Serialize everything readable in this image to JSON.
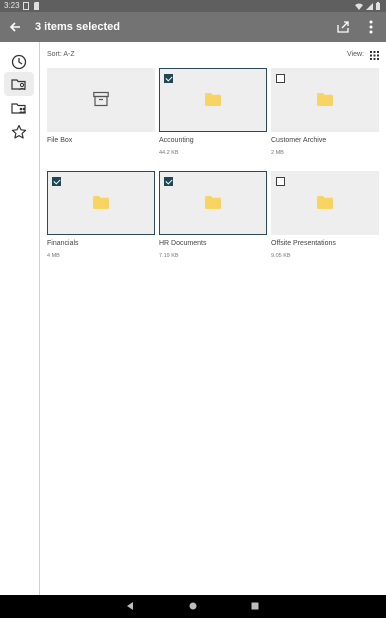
{
  "statusbar": {
    "time": "3:23"
  },
  "appbar": {
    "title": "3 items selected",
    "back_icon": "arrow-back-icon",
    "share_icon": "share-icon",
    "more_icon": "more-vert-icon"
  },
  "rail": {
    "items": [
      {
        "icon": "recent-clock-icon"
      },
      {
        "icon": "folder-user-icon"
      },
      {
        "icon": "shared-folders-icon"
      },
      {
        "icon": "star-icon"
      }
    ]
  },
  "toolbar": {
    "sort_label": "Sort: A-Z",
    "view_label": "View:",
    "view_icon": "grid-view-icon"
  },
  "items": [
    {
      "name": "File Box",
      "size": "",
      "type": "filebox",
      "selected": false
    },
    {
      "name": "Accounting",
      "size": "44.2 KB",
      "type": "folder",
      "selected": true
    },
    {
      "name": "Customer Archive",
      "size": "2 MB",
      "type": "folder",
      "selected": false
    },
    {
      "name": "Financials",
      "size": "4 MB",
      "type": "folder",
      "selected": true
    },
    {
      "name": "HR Documents",
      "size": "7.19 KB",
      "type": "folder",
      "selected": true
    },
    {
      "name": "Offsite Presentations",
      "size": "9.05 KB",
      "type": "folder",
      "selected": false
    }
  ],
  "colors": {
    "appbar": "#737373",
    "folder": "#f8d462",
    "selected_border": "#2b4a55"
  }
}
